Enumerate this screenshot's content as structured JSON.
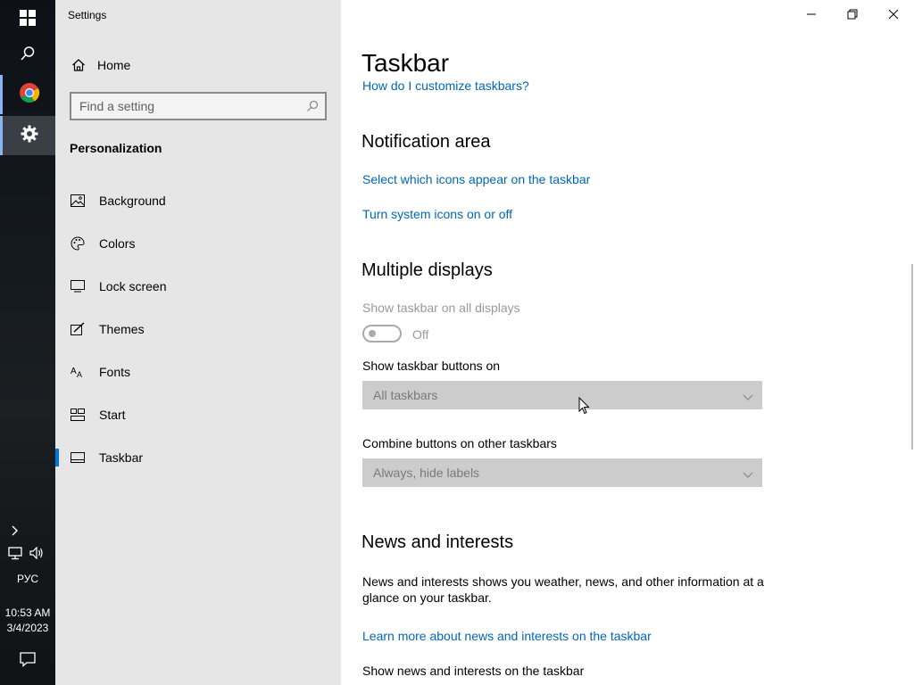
{
  "taskbar": {
    "language": "РУС",
    "time": "10:53 AM",
    "date": "3/4/2023",
    "icons": [
      "windows-start-icon",
      "search-icon",
      "chrome-icon",
      "settings-gear-icon",
      "chevron-up-icon",
      "network-icon",
      "volume-icon",
      "action-center-icon"
    ]
  },
  "window": {
    "title": "Settings"
  },
  "sidebar": {
    "home_label": "Home",
    "search_placeholder": "Find a setting",
    "section": "Personalization",
    "items": [
      {
        "label": "Background",
        "icon": "picture-icon"
      },
      {
        "label": "Colors",
        "icon": "palette-icon"
      },
      {
        "label": "Lock screen",
        "icon": "lock-screen-icon"
      },
      {
        "label": "Themes",
        "icon": "brush-icon"
      },
      {
        "label": "Fonts",
        "icon": "font-icon"
      },
      {
        "label": "Start",
        "icon": "start-tiles-icon"
      },
      {
        "label": "Taskbar",
        "icon": "taskbar-icon",
        "selected": true
      }
    ]
  },
  "main": {
    "title": "Taskbar",
    "customize_link": "How do I customize taskbars?",
    "notification_area": {
      "heading": "Notification area",
      "link1": "Select which icons appear on the taskbar",
      "link2": "Turn system icons on or off"
    },
    "multiple_displays": {
      "heading": "Multiple displays",
      "show_on_all_label": "Show taskbar on all displays",
      "toggle_state": "Off",
      "buttons_on_label": "Show taskbar buttons on",
      "buttons_on_value": "All taskbars",
      "combine_label": "Combine buttons on other taskbars",
      "combine_value": "Always, hide labels"
    },
    "news": {
      "heading": "News and interests",
      "description": "News and interests shows you weather, news, and other information at a glance on your taskbar.",
      "learn_more": "Learn more about news and interests on the taskbar",
      "show_label": "Show news and interests on the taskbar"
    }
  },
  "colors": {
    "accent": "#0078d7",
    "link": "#0067b8",
    "sidebar_bg": "#e6e6e6",
    "dropdown_disabled": "#cccccc"
  }
}
